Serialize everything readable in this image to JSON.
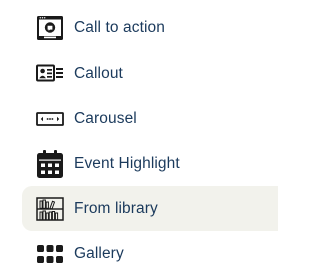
{
  "menu": {
    "items": [
      {
        "label": "Call to action",
        "icon": "call-to-action-icon"
      },
      {
        "label": "Callout",
        "icon": "callout-icon"
      },
      {
        "label": "Carousel",
        "icon": "carousel-icon"
      },
      {
        "label": "Event Highlight",
        "icon": "calendar-icon"
      },
      {
        "label": "From library",
        "icon": "library-icon",
        "highlighted": true
      },
      {
        "label": "Gallery",
        "icon": "gallery-icon"
      }
    ]
  },
  "colors": {
    "text": "#1b3a5c",
    "icon": "#1a1a1a",
    "highlight_background": "#f2f2ec"
  }
}
